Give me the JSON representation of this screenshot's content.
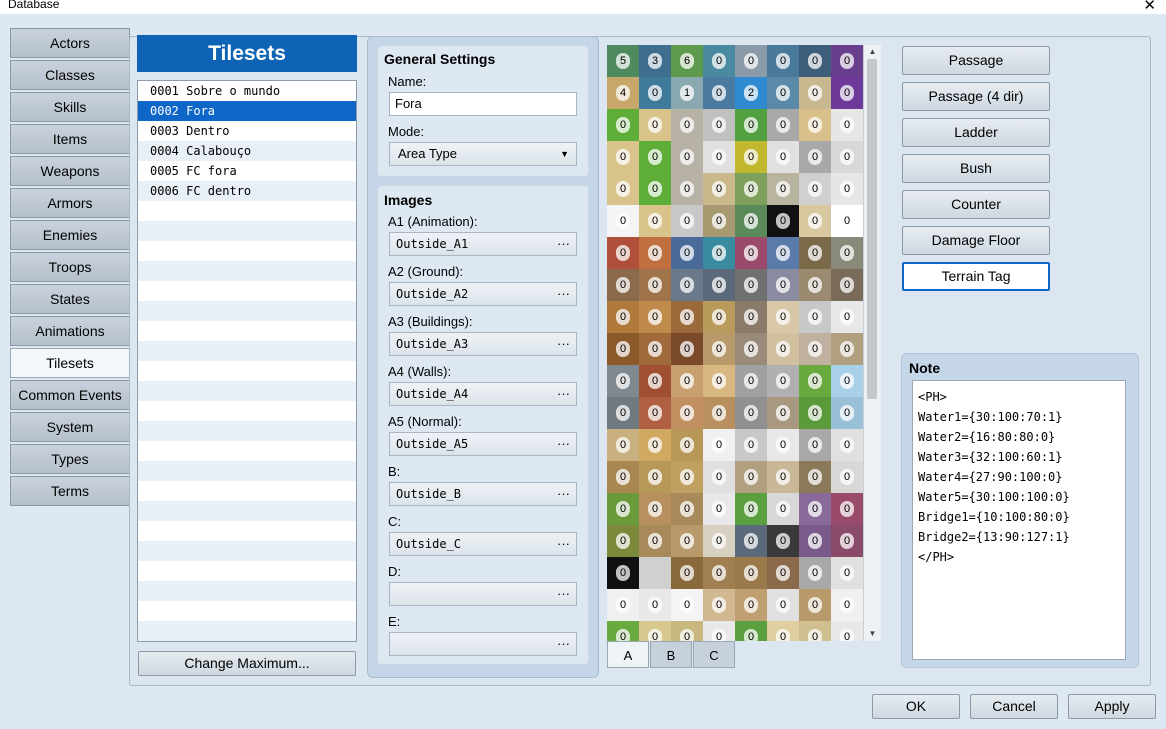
{
  "window": {
    "title": "Database",
    "close_label": "✕"
  },
  "categories": [
    "Actors",
    "Classes",
    "Skills",
    "Items",
    "Weapons",
    "Armors",
    "Enemies",
    "Troops",
    "States",
    "Animations",
    "Tilesets",
    "Common Events",
    "System",
    "Types",
    "Terms"
  ],
  "active_category": "Tilesets",
  "tilesets": {
    "header": "Tilesets",
    "rows": [
      "0001 Sobre o mundo",
      "0002 Fora",
      "0003 Dentro",
      "0004 Calabouço",
      "0005 FC fora",
      "0006 FC dentro"
    ],
    "selected_index": 1,
    "change_max_label": "Change Maximum..."
  },
  "general": {
    "title": "General Settings",
    "name_label": "Name:",
    "name_value": "Fora",
    "mode_label": "Mode:",
    "mode_value": "Area Type"
  },
  "images": {
    "title": "Images",
    "slots": [
      {
        "label": "A1 (Animation):",
        "value": "Outside_A1"
      },
      {
        "label": "A2 (Ground):",
        "value": "Outside_A2"
      },
      {
        "label": "A3 (Buildings):",
        "value": "Outside_A3"
      },
      {
        "label": "A4 (Walls):",
        "value": "Outside_A4"
      },
      {
        "label": "A5 (Normal):",
        "value": "Outside_A5"
      },
      {
        "label": "B:",
        "value": "Outside_B"
      },
      {
        "label": "C:",
        "value": "Outside_C"
      },
      {
        "label": "D:",
        "value": ""
      },
      {
        "label": "E:",
        "value": ""
      }
    ],
    "browse_label": "···"
  },
  "palette": {
    "tabs": [
      "A",
      "B",
      "C"
    ],
    "active_tab": "A",
    "scroll_up": "▲",
    "scroll_down": "▼",
    "rows": [
      {
        "colors": [
          "#4f8a5e",
          "#3d6e8e",
          "#5e9a4e",
          "#4a8aa0",
          "#8a9aa8",
          "#4a7a9a",
          "#3d5e7a",
          "#6a3e8e"
        ],
        "labels": [
          "5",
          "3",
          "6",
          "0",
          "0",
          "0",
          "0",
          "0"
        ]
      },
      {
        "colors": [
          "#c7a86a",
          "#3f7a9a",
          "#8aa8b0",
          "#4a7aa0",
          "#2f8ad0",
          "#5a8aa8",
          "#c8b890",
          "#6e3a9a"
        ],
        "labels": [
          "4",
          "0",
          "1",
          "0",
          "2",
          "0",
          "0",
          "0"
        ]
      },
      {
        "colors": [
          "#5fae3a",
          "#d8c48a",
          "#b8b2a6",
          "#c0c0c0",
          "#52a040",
          "#a8a8a8",
          "#d9c08a",
          "#e6e6e6"
        ],
        "labels": [
          "0",
          "0",
          "0",
          "0",
          "0",
          "0",
          "0",
          "0"
        ]
      },
      {
        "colors": [
          "#d8c48a",
          "#5fae3a",
          "#b8b2a6",
          "#e0e0e0",
          "#c2b830",
          "#e0e0e0",
          "#a8a8a8",
          "#d8d8d8"
        ],
        "labels": [
          "0",
          "0",
          "0",
          "0",
          "0",
          "0",
          "0",
          "0"
        ]
      },
      {
        "colors": [
          "#d8c48a",
          "#5fae3a",
          "#b8b2a6",
          "#c8b88a",
          "#7fa05a",
          "#b8b4a0",
          "#d0d0d0",
          "#e6e6e6"
        ],
        "labels": [
          "0",
          "0",
          "0",
          "0",
          "0",
          "0",
          "0",
          "0"
        ]
      },
      {
        "colors": [
          "#f4f4f4",
          "#d8c48a",
          "#c8c8c8",
          "#a89a70",
          "#5a8a5a",
          "#111111",
          "#d8c8a0",
          "#ffffff"
        ],
        "labels": [
          "0",
          "0",
          "0",
          "0",
          "0",
          "0",
          "0",
          "0"
        ]
      },
      {
        "colors": [
          "#b0503a",
          "#c07040",
          "#4a6a9a",
          "#3a8aa0",
          "#9a4a6a",
          "#5a7aaa",
          "#7a6a4a",
          "#8a8a7a"
        ],
        "labels": [
          "0",
          "0",
          "0",
          "0",
          "0",
          "0",
          "0",
          "0"
        ]
      },
      {
        "colors": [
          "#8a6a4a",
          "#a0744a",
          "#6a7a8a",
          "#5a6a7a",
          "#707070",
          "#8a8aa0",
          "#9a8a70",
          "#7a6a5a"
        ],
        "labels": [
          "0",
          "0",
          "0",
          "0",
          "0",
          "0",
          "0",
          "0"
        ]
      },
      {
        "colors": [
          "#b07a3a",
          "#c08a4a",
          "#9a6a3a",
          "#b89a5a",
          "#8a7a6a",
          "#d8c8a8",
          "#c8c8c8",
          "#e8e8e8"
        ],
        "labels": [
          "0",
          "0",
          "0",
          "0",
          "0",
          "0",
          "0",
          "0"
        ]
      },
      {
        "colors": [
          "#8a5a2a",
          "#a06a3a",
          "#7a4a2a",
          "#b89a6a",
          "#9a8a7a",
          "#d0c0a0",
          "#c0b0a0",
          "#b0a080"
        ],
        "labels": [
          "0",
          "0",
          "0",
          "0",
          "0",
          "0",
          "0",
          "0"
        ]
      },
      {
        "colors": [
          "#808890",
          "#a05030",
          "#c8a070",
          "#d8b880",
          "#a0a0a0",
          "#b0b0b0",
          "#6aa840",
          "#a8d0e8"
        ],
        "labels": [
          "0",
          "0",
          "0",
          "0",
          "0",
          "0",
          "0",
          "0"
        ]
      },
      {
        "colors": [
          "#707880",
          "#b06040",
          "#c09060",
          "#b89060",
          "#909090",
          "#a89880",
          "#5a9a3a",
          "#9ac0d8"
        ],
        "labels": [
          "0",
          "0",
          "0",
          "0",
          "0",
          "0",
          "0",
          "0"
        ]
      },
      {
        "colors": [
          "#c8b080",
          "#d0a860",
          "#b89858",
          "#f0f0f0",
          "#c8c8c8",
          "#e8e8e8",
          "#a8a8a8",
          "#e0e0e0"
        ],
        "labels": [
          "0",
          "0",
          "0",
          "0",
          "0",
          "0",
          "0",
          "0"
        ]
      },
      {
        "colors": [
          "#a88850",
          "#b89858",
          "#c0a060",
          "#e0e0e0",
          "#b0a080",
          "#c8b898",
          "#8a7a5a",
          "#d8d8d8"
        ],
        "labels": [
          "0",
          "0",
          "0",
          "0",
          "0",
          "0",
          "0",
          "0"
        ]
      },
      {
        "colors": [
          "#6a9a3a",
          "#b89060",
          "#a88a5a",
          "#e8e8e8",
          "#5aa040",
          "#d8d8d8",
          "#8a6a9a",
          "#9a4a6a"
        ],
        "labels": [
          "0",
          "0",
          "0",
          "0",
          "0",
          "0",
          "0",
          "0"
        ]
      },
      {
        "colors": [
          "#7a8a3a",
          "#a88a5a",
          "#b89a6a",
          "#d8d0c0",
          "#5a6a7a",
          "#3a3a3a",
          "#7a5a8a",
          "#8a4a6a"
        ],
        "labels": [
          "0",
          "0",
          "0",
          "0",
          "0",
          "0",
          "0",
          "0"
        ]
      },
      {
        "colors": [
          "#101010",
          "#d0d0d0",
          "#8a6a3a",
          "#a08050",
          "#9a7a4a",
          "#8a6a4a",
          "#a8a8a8",
          "#e0e0e0"
        ],
        "labels": [
          "0",
          "",
          "0",
          "0",
          "0",
          "0",
          "0",
          "0"
        ]
      },
      {
        "colors": [
          "#f0f0f0",
          "#e8e8e8",
          "#f4f4f4",
          "#d0b890",
          "#c0a070",
          "#e0e0e0",
          "#b89a6a",
          "#f0f0f0"
        ],
        "labels": [
          "0",
          "0",
          "0",
          "0",
          "0",
          "0",
          "0",
          "0"
        ]
      },
      {
        "colors": [
          "#6aa840",
          "#d8c890",
          "#c8b880",
          "#e8e8e8",
          "#5aa040",
          "#e0d0a0",
          "#d0c090",
          "#e8e8e8"
        ],
        "labels": [
          "0",
          "0",
          "0",
          "0",
          "0",
          "0",
          "0",
          "0"
        ]
      }
    ]
  },
  "flags": {
    "buttons": [
      "Passage",
      "Passage (4 dir)",
      "Ladder",
      "Bush",
      "Counter",
      "Damage Floor",
      "Terrain Tag"
    ],
    "active": "Terrain Tag"
  },
  "note": {
    "title": "Note",
    "lines": [
      "<PH>",
      "Water1={30:100:70:1}",
      "Water2={16:80:80:0}",
      "Water3={32:100:60:1}",
      "Water4={27:90:100:0}",
      "Water5={30:100:100:0}",
      "Bridge1={10:100:80:0}",
      "Bridge2={13:90:127:1}",
      "</PH>"
    ]
  },
  "footer": {
    "ok": "OK",
    "cancel": "Cancel",
    "apply": "Apply"
  }
}
